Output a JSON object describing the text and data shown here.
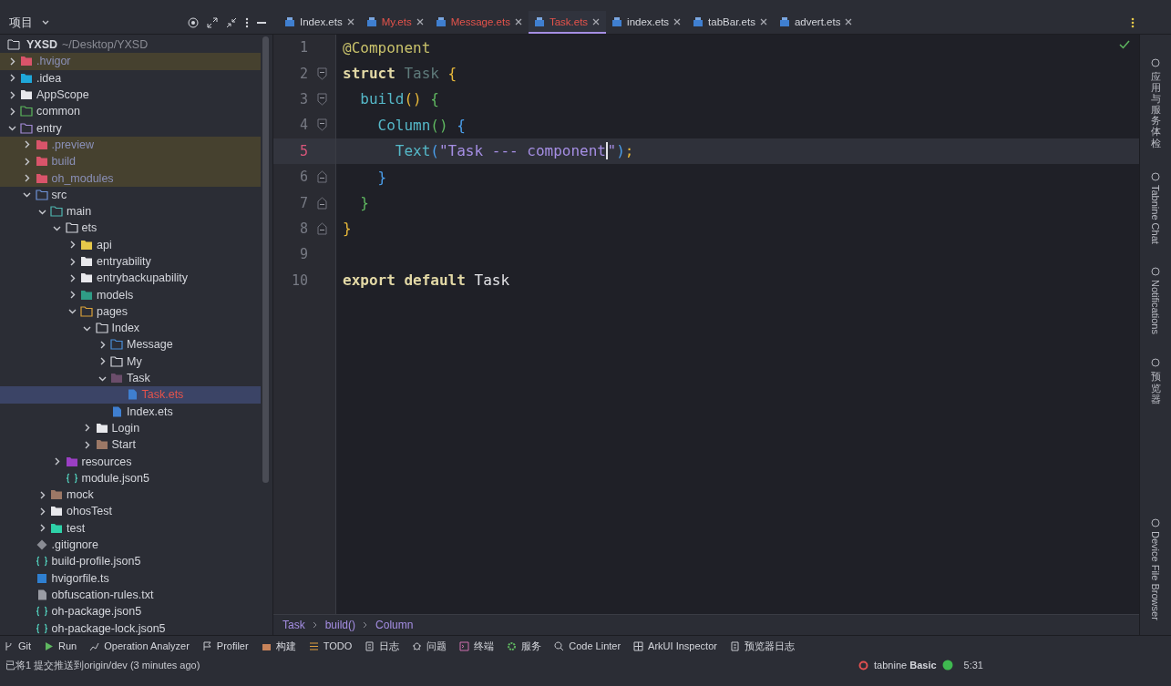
{
  "project_panel": {
    "title": "项目",
    "root": {
      "name": "YXSD",
      "path": "~/Desktop/YXSD"
    },
    "tree": [
      {
        "label": ".hvigor",
        "kind": "excluded",
        "excluded": true,
        "modified": false,
        "selected": false,
        "expanded": false
      },
      {
        "label": ".idea",
        "kind": "idea",
        "excluded": false,
        "modified": false,
        "selected": false,
        "expanded": false
      },
      {
        "label": "AppScope",
        "kind": "folder",
        "excluded": false,
        "modified": false,
        "selected": false,
        "expanded": false
      },
      {
        "label": "common",
        "kind": "module-green",
        "excluded": false,
        "modified": false,
        "selected": false,
        "expanded": false
      },
      {
        "label": "entry",
        "kind": "module",
        "excluded": false,
        "modified": false,
        "selected": false,
        "expanded": true,
        "children": [
          {
            "label": ".preview",
            "kind": "excluded",
            "excluded": true,
            "modified": false,
            "selected": false,
            "expanded": false
          },
          {
            "label": "build",
            "kind": "excluded",
            "excluded": true,
            "modified": false,
            "selected": false,
            "expanded": false
          },
          {
            "label": "oh_modules",
            "kind": "excluded",
            "excluded": true,
            "modified": false,
            "selected": false,
            "expanded": false
          },
          {
            "label": "src",
            "kind": "source",
            "excluded": false,
            "modified": false,
            "selected": false,
            "expanded": true,
            "children": [
              {
                "label": "main",
                "kind": "module-teal",
                "excluded": false,
                "modified": false,
                "selected": false,
                "expanded": true,
                "children": [
                  {
                    "label": "ets",
                    "kind": "outline",
                    "excluded": false,
                    "modified": false,
                    "selected": false,
                    "expanded": true,
                    "children": [
                      {
                        "label": "api",
                        "kind": "api",
                        "excluded": false,
                        "modified": false,
                        "selected": false,
                        "expanded": false
                      },
                      {
                        "label": "entryability",
                        "kind": "folder",
                        "excluded": false,
                        "modified": false,
                        "selected": false,
                        "expanded": false
                      },
                      {
                        "label": "entrybackupability",
                        "kind": "folder",
                        "excluded": false,
                        "modified": false,
                        "selected": false,
                        "expanded": false
                      },
                      {
                        "label": "models",
                        "kind": "models",
                        "excluded": false,
                        "modified": false,
                        "selected": false,
                        "expanded": false
                      },
                      {
                        "label": "pages",
                        "kind": "pages",
                        "excluded": false,
                        "modified": false,
                        "selected": false,
                        "expanded": true,
                        "children": [
                          {
                            "label": "Index",
                            "kind": "outline",
                            "excluded": false,
                            "modified": false,
                            "selected": false,
                            "expanded": true,
                            "children": [
                              {
                                "label": "Message",
                                "kind": "message",
                                "excluded": false,
                                "modified": false,
                                "selected": false,
                                "expanded": false
                              },
                              {
                                "label": "My",
                                "kind": "outline",
                                "excluded": false,
                                "modified": false,
                                "selected": false,
                                "expanded": false
                              },
                              {
                                "label": "Task",
                                "kind": "task",
                                "excluded": false,
                                "modified": false,
                                "selected": false,
                                "expanded": true,
                                "children": [
                                  {
                                    "label": "Task.ets",
                                    "kind": "ets",
                                    "excluded": false,
                                    "modified": true,
                                    "selected": true
                                  }
                                ]
                              },
                              {
                                "label": "Index.ets",
                                "kind": "ets",
                                "excluded": false,
                                "modified": false,
                                "selected": false
                              }
                            ]
                          },
                          {
                            "label": "Login",
                            "kind": "folder",
                            "excluded": false,
                            "modified": false,
                            "selected": false,
                            "expanded": false
                          },
                          {
                            "label": "Start",
                            "kind": "mock",
                            "excluded": false,
                            "modified": false,
                            "selected": false,
                            "expanded": false
                          }
                        ]
                      }
                    ]
                  },
                  {
                    "label": "resources",
                    "kind": "resources",
                    "excluded": false,
                    "modified": false,
                    "selected": false,
                    "expanded": false
                  },
                  {
                    "label": "module.json5",
                    "kind": "json5",
                    "excluded": false,
                    "modified": false,
                    "selected": false
                  }
                ]
              },
              {
                "label": "mock",
                "kind": "mock",
                "excluded": false,
                "modified": false,
                "selected": false,
                "expanded": false
              },
              {
                "label": "ohosTest",
                "kind": "folder",
                "excluded": false,
                "modified": false,
                "selected": false,
                "expanded": false
              },
              {
                "label": "test",
                "kind": "test",
                "excluded": false,
                "modified": false,
                "selected": false,
                "expanded": false
              }
            ]
          },
          {
            "label": ".gitignore",
            "kind": "git",
            "excluded": false,
            "modified": false,
            "selected": false
          },
          {
            "label": "build-profile.json5",
            "kind": "json5",
            "excluded": false,
            "modified": false,
            "selected": false
          },
          {
            "label": "hvigorfile.ts",
            "kind": "ts",
            "excluded": false,
            "modified": false,
            "selected": false
          },
          {
            "label": "obfuscation-rules.txt",
            "kind": "txt",
            "excluded": false,
            "modified": false,
            "selected": false
          },
          {
            "label": "oh-package.json5",
            "kind": "json5",
            "excluded": false,
            "modified": false,
            "selected": false
          },
          {
            "label": "oh-package-lock.json5",
            "kind": "json5",
            "excluded": false,
            "modified": false,
            "selected": false
          }
        ]
      }
    ]
  },
  "tabs": [
    {
      "label": "Index.ets",
      "modified": false,
      "selected": false
    },
    {
      "label": "My.ets",
      "modified": true,
      "selected": false
    },
    {
      "label": "Message.ets",
      "modified": true,
      "selected": false
    },
    {
      "label": "Task.ets",
      "modified": true,
      "selected": true
    },
    {
      "label": "index.ets",
      "modified": false,
      "selected": false
    },
    {
      "label": "tabBar.ets",
      "modified": false,
      "selected": false
    },
    {
      "label": "advert.ets",
      "modified": false,
      "selected": false
    }
  ],
  "editor": {
    "lines": [
      {
        "number": "1",
        "current": false,
        "kind": "plain",
        "tokens": [
          {
            "text": "@Component",
            "kind": "annotation"
          }
        ]
      },
      {
        "number": "2",
        "current": false,
        "kind": "opener",
        "tokens": [
          {
            "text": "struct",
            "kind": "keyword"
          },
          {
            "text": " Task",
            "kind": "dim"
          },
          {
            "text": " {",
            "kind": "yellow"
          }
        ]
      },
      {
        "number": "3",
        "current": false,
        "kind": "opener",
        "tokens": [
          {
            "text": "  build",
            "kind": "func"
          },
          {
            "text": "()",
            "kind": "yellow"
          },
          {
            "text": " {",
            "kind": "green"
          }
        ]
      },
      {
        "number": "4",
        "current": false,
        "kind": "opener",
        "tokens": [
          {
            "text": "    Column",
            "kind": "func"
          },
          {
            "text": "()",
            "kind": "green"
          },
          {
            "text": " {",
            "kind": "blue"
          }
        ]
      },
      {
        "number": "5",
        "current": true,
        "kind": "plain",
        "tokens": [
          {
            "text": "      Text",
            "kind": "func"
          },
          {
            "text": "(",
            "kind": "blue"
          },
          {
            "text": "\"Task --- component",
            "kind": "string",
            "caret": true
          },
          {
            "text": "\"",
            "kind": "string"
          },
          {
            "text": ")",
            "kind": "blue"
          },
          {
            "text": ";",
            "kind": "yellow"
          }
        ]
      },
      {
        "number": "6",
        "current": false,
        "kind": "closer",
        "tokens": [
          {
            "text": "    }",
            "kind": "blue"
          }
        ]
      },
      {
        "number": "7",
        "current": false,
        "kind": "closer",
        "tokens": [
          {
            "text": "  }",
            "kind": "green"
          }
        ]
      },
      {
        "number": "8",
        "current": false,
        "kind": "closer",
        "tokens": [
          {
            "text": "}",
            "kind": "yellow"
          }
        ]
      },
      {
        "number": "9",
        "current": false,
        "kind": "plain"
      },
      {
        "number": "10",
        "current": false,
        "kind": "plain",
        "tokens": [
          {
            "text": "export",
            "kind": "keyword"
          },
          {
            "text": " default",
            "kind": "keyword"
          },
          {
            "text": " Task",
            "kind": "plain"
          }
        ]
      }
    ],
    "breadcrumbs": [
      "Task",
      "build()",
      "Column"
    ]
  },
  "right_strip": [
    {
      "label": "应用与服务体检",
      "kind": "cjk"
    },
    {
      "label": "Tabnine Chat",
      "kind": "latin"
    },
    {
      "label": "Notifications",
      "kind": "latin"
    },
    {
      "label": "预览器",
      "kind": "cjk"
    },
    {
      "label": "Device File Browser",
      "kind": "latin"
    }
  ],
  "tool_windows": [
    "Git",
    "Run",
    "Operation Analyzer",
    "Profiler",
    "构建",
    "TODO",
    "日志",
    "问题",
    "终端",
    "服务",
    "Code Linter",
    "ArkUI Inspector",
    "预览器日志"
  ],
  "status_bar": {
    "message": "已将1 提交推送到origin/dev (3 minutes ago)",
    "plugin": "tabnine **Basic**",
    "position": "5:31"
  }
}
